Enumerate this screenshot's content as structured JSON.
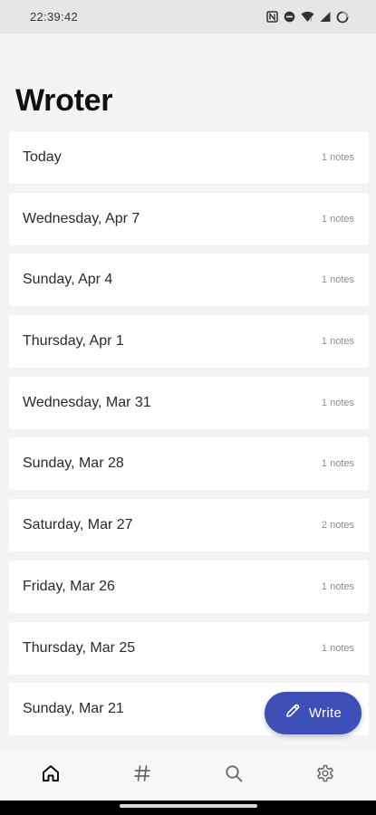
{
  "status_bar": {
    "time": "22:39:42",
    "icons": [
      "nfc-icon",
      "do-not-disturb-icon",
      "wifi-icon",
      "signal-icon",
      "battery-icon"
    ]
  },
  "app": {
    "title": "Wroter"
  },
  "days": [
    {
      "label": "Today",
      "count": "1 notes"
    },
    {
      "label": "Wednesday, Apr 7",
      "count": "1 notes"
    },
    {
      "label": "Sunday, Apr 4",
      "count": "1 notes"
    },
    {
      "label": "Thursday, Apr 1",
      "count": "1 notes"
    },
    {
      "label": "Wednesday, Mar 31",
      "count": "1 notes"
    },
    {
      "label": "Sunday, Mar 28",
      "count": "1 notes"
    },
    {
      "label": "Saturday, Mar 27",
      "count": "2 notes"
    },
    {
      "label": "Friday, Mar 26",
      "count": "1 notes"
    },
    {
      "label": "Thursday, Mar 25",
      "count": "1 notes"
    },
    {
      "label": "Sunday, Mar 21",
      "count": ""
    }
  ],
  "fab": {
    "label": "Write",
    "icon": "pencil-icon",
    "color": "#3f4fb8"
  },
  "bottom_nav": {
    "active": "home",
    "items": [
      {
        "id": "home",
        "icon": "home-icon"
      },
      {
        "id": "tags",
        "icon": "hashtag-icon"
      },
      {
        "id": "search",
        "icon": "search-icon"
      },
      {
        "id": "settings",
        "icon": "gear-icon"
      }
    ]
  }
}
